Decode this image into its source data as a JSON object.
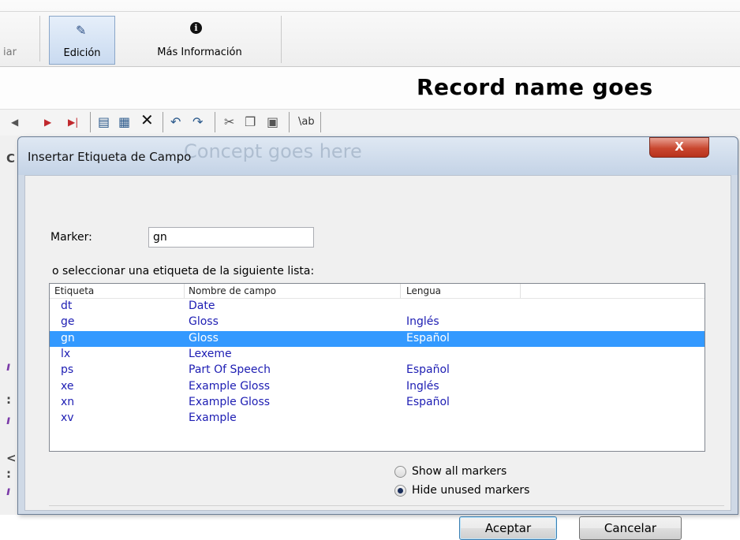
{
  "toolbar": {
    "prev_label": "iar",
    "edit_label": "Edición",
    "info_label": "Más Información",
    "info_icon": "i"
  },
  "record": {
    "title": "Record name goes"
  },
  "edit_toolbar": {
    "items": [
      "◂",
      "▸",
      "▸|",
      "new-field-icon",
      "copy-field-icon",
      "delete-icon",
      "undo-icon",
      "redo-icon",
      "cut-icon",
      "copy-icon",
      "paste-icon",
      "text-tag-icon"
    ]
  },
  "dialog": {
    "title": "Insertar Etiqueta de Campo",
    "ghost_text": "Concept goes here",
    "close_glyph": "X",
    "marker_label": "Marker:",
    "marker_value": "gn",
    "list_caption": "o seleccionar una etiqueta de la siguiente lista:",
    "columns": [
      "Etiqueta",
      "Nombre de campo",
      "Lengua"
    ],
    "rows": [
      {
        "tag": "dt",
        "name": "Date",
        "lang": ""
      },
      {
        "tag": "ge",
        "name": "Gloss",
        "lang": "Inglés"
      },
      {
        "tag": "gn",
        "name": "Gloss",
        "lang": "Español",
        "selected": true
      },
      {
        "tag": "lx",
        "name": "Lexeme",
        "lang": ""
      },
      {
        "tag": "ps",
        "name": "Part Of Speech",
        "lang": "Español"
      },
      {
        "tag": "xe",
        "name": "Example Gloss",
        "lang": "Inglés"
      },
      {
        "tag": "xn",
        "name": "Example Gloss",
        "lang": "Español"
      },
      {
        "tag": "xv",
        "name": "Example",
        "lang": ""
      }
    ],
    "options": {
      "show_all": "Show all markers",
      "hide_unused": "Hide unused markers",
      "selected": "hide_unused"
    },
    "accept_label": "Aceptar",
    "cancel_label": "Cancelar"
  },
  "colors": {
    "selection": "#3399ff",
    "list_text": "#1d1db3",
    "close_button": "#c9472f"
  }
}
